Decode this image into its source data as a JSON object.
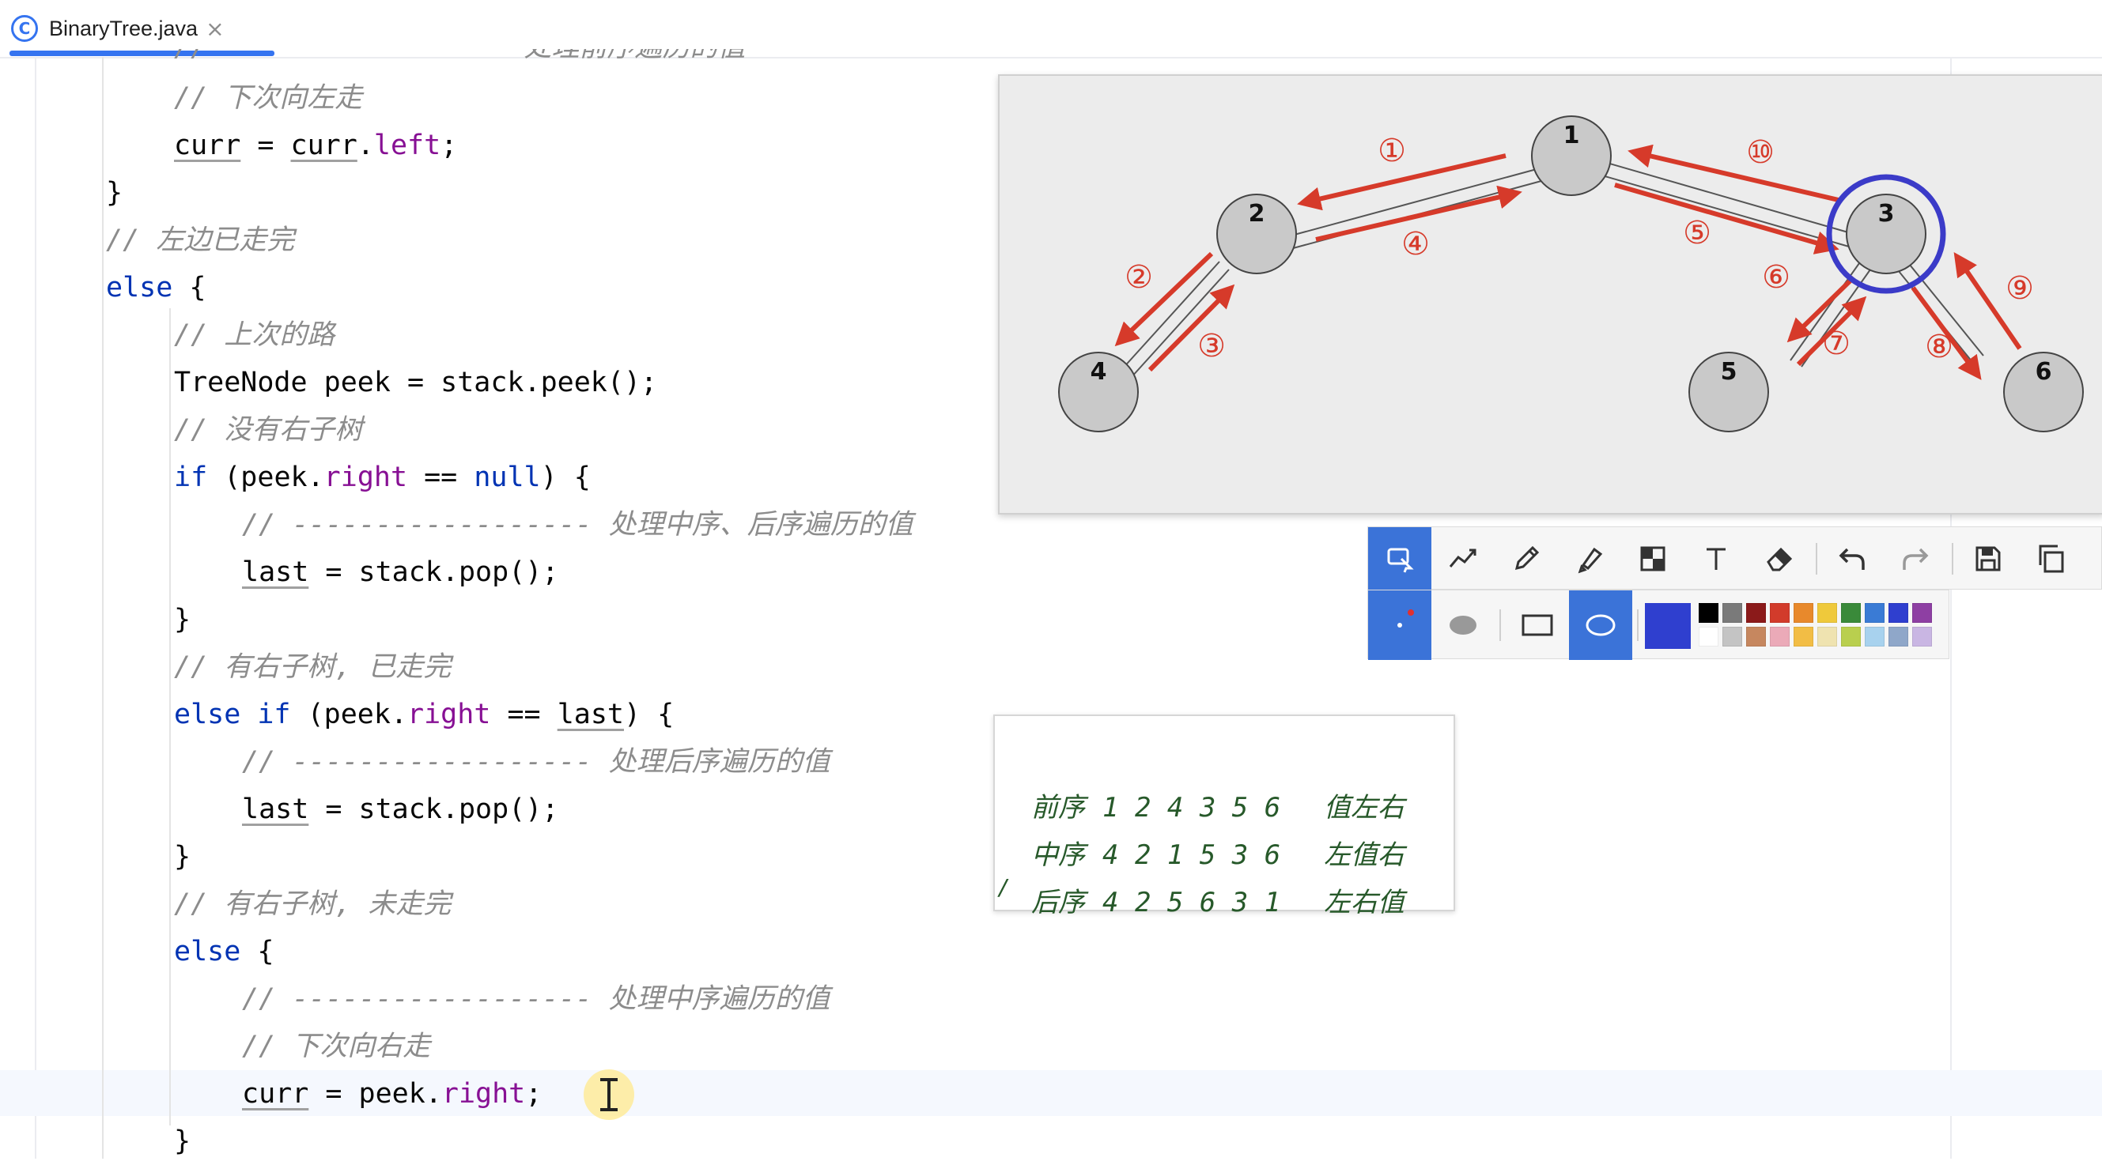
{
  "tab": {
    "icon_letter": "C",
    "filename": "BinaryTree.java",
    "close": "×"
  },
  "code": {
    "partial_top": "//                   处理前序遍历的值",
    "lines": [
      [
        "//",
        " 下次向左走"
      ],
      [
        "curr",
        " = ",
        "curr",
        ".",
        "left",
        ";"
      ],
      [
        "}"
      ],
      [
        "//",
        " 左边已走完"
      ],
      [
        "else",
        " {"
      ],
      [
        "//",
        " 上次的路"
      ],
      [
        "TreeNode peek = stack.peek();"
      ],
      [
        "//",
        " 没有右子树"
      ],
      [
        "if",
        " (peek.",
        "right",
        " == ",
        "null",
        ") {"
      ],
      [
        "// ------------------ 处理中序、后序遍历的值"
      ],
      [
        "last",
        " = stack.pop();"
      ],
      [
        "}"
      ],
      [
        "//",
        " 有右子树, 已走完"
      ],
      [
        "else if",
        " (peek.",
        "right",
        " == ",
        "last",
        ") {"
      ],
      [
        "// ------------------ 处理后序遍历的值"
      ],
      [
        "last",
        " = stack.pop();"
      ],
      [
        "}"
      ],
      [
        "//",
        " 有右子树, 未走完"
      ],
      [
        "else",
        " {"
      ],
      [
        "// ------------------ 处理中序遍历的值"
      ],
      [
        "// 下次向右走"
      ],
      [
        "curr",
        " = peek.",
        "right",
        ";"
      ],
      [
        "}"
      ]
    ]
  },
  "tree": {
    "nodes": [
      "1",
      "2",
      "3",
      "4",
      "5",
      "6"
    ],
    "step_labels": [
      "①",
      "②",
      "③",
      "④",
      "⑤",
      "⑥",
      "⑦",
      "⑧",
      "⑨",
      "⑩"
    ],
    "highlighted_node": "3"
  },
  "toolbar": {
    "row1_tools": [
      "select-shape-icon",
      "polyline-icon",
      "pencil-icon",
      "highlighter-icon",
      "mosaic-icon",
      "text-icon",
      "eraser-icon",
      "undo-icon",
      "redo-icon",
      "save-icon",
      "copy-icon"
    ],
    "row2_tools": [
      "dot-size-icon",
      "filled-ellipse-icon",
      "rectangle-icon",
      "ellipse-icon"
    ],
    "current_color": "#2f3fcf",
    "palette_top": [
      "#000000",
      "#7a7a7a",
      "#8b1a1a",
      "#d23b2b",
      "#e8892c",
      "#efc93b",
      "#3a8a3a",
      "#3a7bd5",
      "#2f3fcf",
      "#8e3fa3"
    ],
    "palette_bottom": [
      "#ffffff",
      "#c4c4c4",
      "#c6875f",
      "#ebaab8",
      "#f2bd45",
      "#efe3b0",
      "#b9cf4e",
      "#a8d2ee",
      "#8fa7c9",
      "#c9b6e3"
    ]
  },
  "traversal": {
    "rows": [
      {
        "name": "前序",
        "sequence": "1 2 4 3 5 6",
        "order": "值左右"
      },
      {
        "name": "中序",
        "sequence": "4 2 1 5 3 6",
        "order": "左值右"
      },
      {
        "name": "后序",
        "sequence": "4 2 5 6 3 1",
        "order": "左右值"
      }
    ],
    "stray_mark": "/"
  },
  "colors": {
    "keyword": "#0033b3",
    "field": "#871094",
    "comment": "#8c8c8c",
    "accent": "#3574f0",
    "arrow": "#d63a2a",
    "highlight_ring": "#3b3bc8"
  }
}
